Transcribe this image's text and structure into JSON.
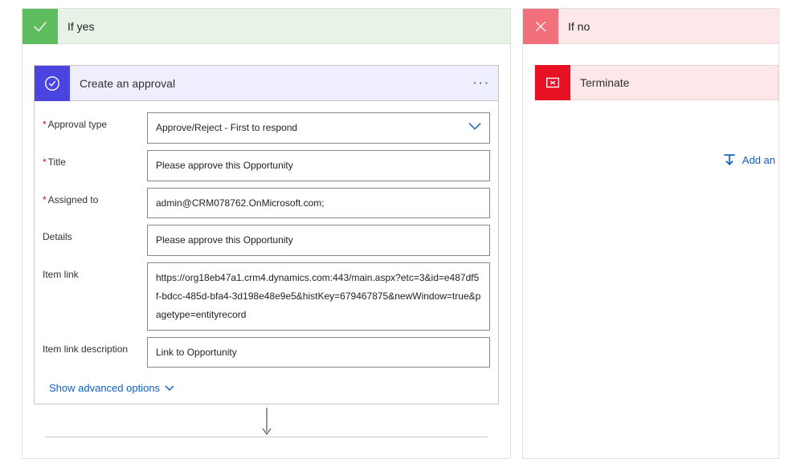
{
  "branches": {
    "yes": {
      "title": "If yes"
    },
    "no": {
      "title": "If no"
    }
  },
  "approvalAction": {
    "title": "Create an approval",
    "fields": {
      "approvalType": {
        "label": "Approval type",
        "value": "Approve/Reject - First to respond"
      },
      "title": {
        "label": "Title",
        "value": "Please approve this Opportunity"
      },
      "assignedTo": {
        "label": "Assigned to",
        "value": "admin@CRM078762.OnMicrosoft.com;"
      },
      "details": {
        "label": "Details",
        "value": "Please approve this Opportunity"
      },
      "itemLink": {
        "label": "Item link",
        "value": "https://org18eb47a1.crm4.dynamics.com:443/main.aspx?etc=3&id=e487df5f-bdcc-485d-bfa4-3d198e48e9e5&histKey=679467875&newWindow=true&pagetype=entityrecord"
      },
      "itemLinkDesc": {
        "label": "Item link description",
        "value": "Link to Opportunity"
      }
    },
    "advancedLabel": "Show advanced options"
  },
  "terminateAction": {
    "title": "Terminate"
  },
  "addActionLabel": "Add an"
}
